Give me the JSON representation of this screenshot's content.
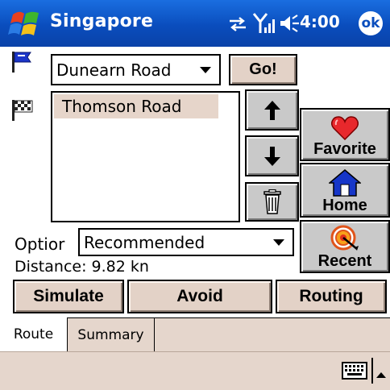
{
  "titlebar": {
    "title": "Singapore",
    "time": "4:00",
    "ok_label": "ok",
    "icons": [
      "windows-start-icon",
      "sync-arrows-icon",
      "signal-icon",
      "speaker-icon"
    ],
    "color": "#0a4dbd"
  },
  "route": {
    "start_value": "Dunearn Road",
    "go_label": "Go!",
    "waypoints": [
      "Thomson Road"
    ],
    "option_label": "Optior",
    "option_value": "Recommended",
    "distance_text": "Distance: 9.82 kn"
  },
  "side_buttons": {
    "favorite": "Favorite",
    "home": "Home",
    "recent": "Recent"
  },
  "actions": {
    "simulate": "Simulate",
    "avoid": "Avoid",
    "routing": "Routing"
  },
  "tabs": [
    {
      "label": "Route",
      "active": true
    },
    {
      "label": "Summary",
      "active": false
    }
  ],
  "colors": {
    "button_face": "#e3d2c7",
    "gray_button": "#c9c9c9",
    "selection": "#e6d5ca",
    "heart": "#e8282c",
    "house": "#1636c8"
  }
}
